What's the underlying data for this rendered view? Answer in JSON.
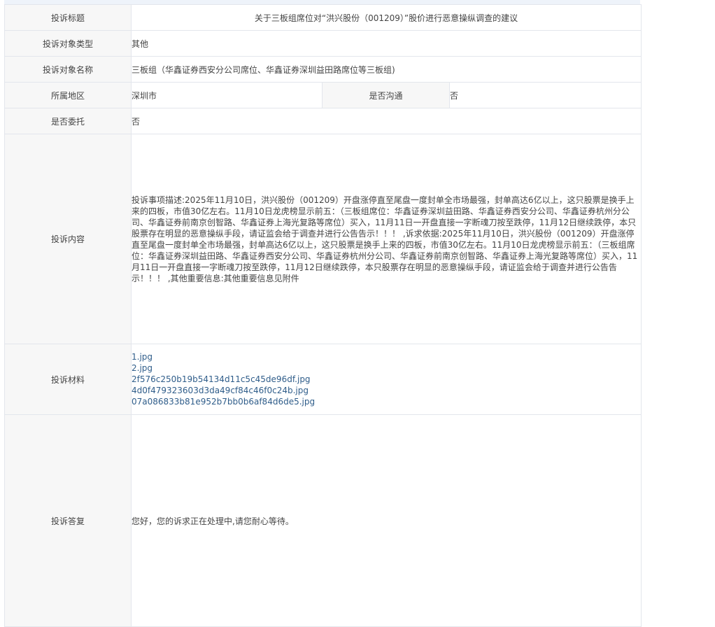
{
  "rows": {
    "title": {
      "label": "投诉标题",
      "value": "关于三板组席位对“洪兴股份（001209）”股价进行恶意操纵调查的建议"
    },
    "target_type": {
      "label": "投诉对象类型",
      "value": "其他"
    },
    "target_name": {
      "label": "投诉对象名称",
      "value": "三板组（华鑫证券西安分公司席位、华鑫证券深圳益田路席位等三板组)"
    },
    "region": {
      "label": "所属地区",
      "value": "深圳市"
    },
    "communicated": {
      "label": "是否沟通",
      "value": "否"
    },
    "entrusted": {
      "label": "是否委托",
      "value": "否"
    },
    "content": {
      "label": "投诉内容",
      "value": "投诉事项描述:2025年11月10日，洪兴股份（001209）开盘涨停直至尾盘一度封单全市场最强，封单高达6亿以上，这只股票是换手上来的四板，市值30亿左右。11月10日龙虎榜显示前五：（三板组席位：华鑫证券深圳益田路、华鑫证券西安分公司、华鑫证券杭州分公司、华鑫证券前南京创智路、华鑫证券上海光复路等席位）买入，11月11日一开盘直接一字断魂刀按至跌停，11月12日继续跌停，本只股票存在明显的恶意操纵手段，请证监会给于调查并进行公告告示！！！ ,诉求依据:2025年11月10日，洪兴股份（001209）开盘涨停直至尾盘一度封单全市场最强，封单高达6亿以上，这只股票是换手上来的四板，市值30亿左右。11月10日龙虎榜显示前五：（三板组席位：华鑫证券深圳益田路、华鑫证券西安分公司、华鑫证券杭州分公司、华鑫证券前南京创智路、华鑫证券上海光复路等席位）买入，11月11日一开盘直接一字断魂刀按至跌停，11月12日继续跌停，本只股票存在明显的恶意操纵手段，请证监会给于调查并进行公告告示！！！ ,其他重要信息:其他重要信息见附件"
    },
    "materials": {
      "label": "投诉材料",
      "files": [
        "1.jpg",
        "2.jpg",
        "2f576c250b19b54134d11c5c45de96df.jpg",
        "4d0f479323603d3da49cf84c46f0c24b.jpg",
        "07a086833b81e952b7bb0b6af84d6de5.jpg"
      ]
    },
    "reply": {
      "label": "投诉答复",
      "value": "您好，您的诉求正在处理中,请您耐心等待。"
    }
  },
  "colors": {
    "label_bg": "#f7f7f7",
    "border": "#e3e6ec",
    "link": "#2f5d8a",
    "text": "#444444"
  }
}
